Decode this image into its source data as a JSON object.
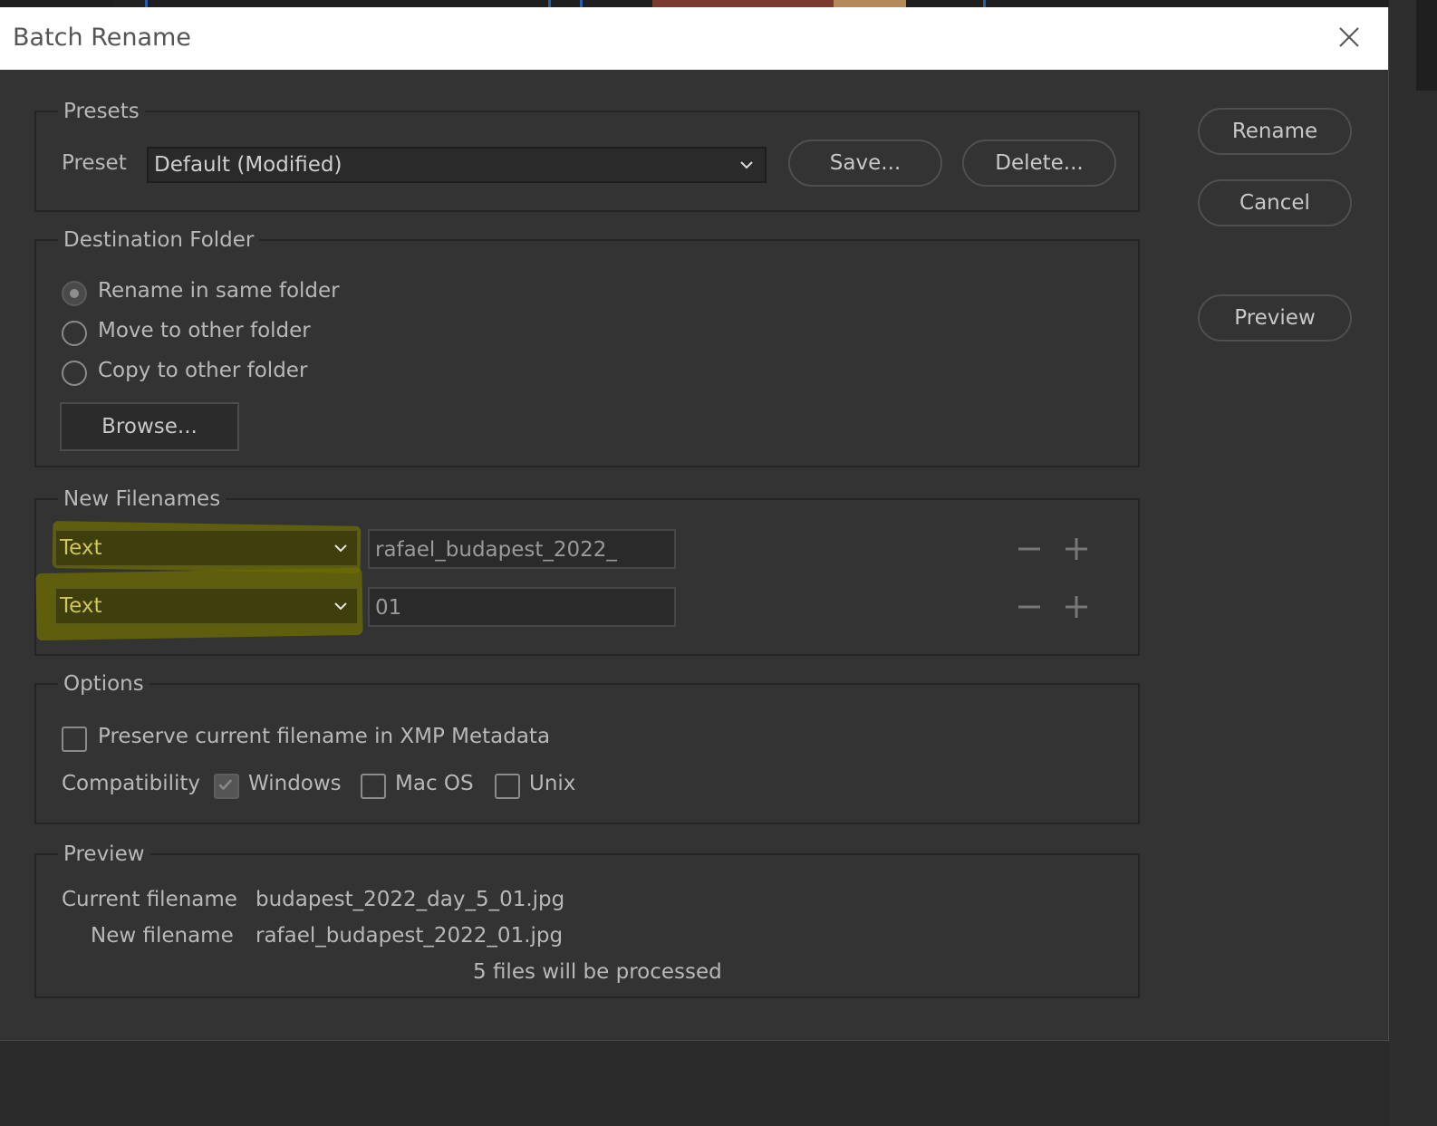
{
  "dialog": {
    "title": "Batch Rename"
  },
  "side_buttons": {
    "rename": "Rename",
    "cancel": "Cancel",
    "preview": "Preview"
  },
  "presets": {
    "legend": "Presets",
    "preset_label": "Preset",
    "preset_value": "Default (Modified)",
    "save_label": "Save...",
    "delete_label": "Delete..."
  },
  "destination": {
    "legend": "Destination Folder",
    "options": [
      {
        "label": "Rename in same folder",
        "selected": true
      },
      {
        "label": "Move to other folder",
        "selected": false
      },
      {
        "label": "Copy to other folder",
        "selected": false
      }
    ],
    "browse_label": "Browse..."
  },
  "new_filenames": {
    "legend": "New Filenames",
    "rows": [
      {
        "type": "Text",
        "value": "rafael_budapest_2022_"
      },
      {
        "type": "Text",
        "value": "01"
      }
    ]
  },
  "options": {
    "legend": "Options",
    "preserve_label": "Preserve current filename in XMP Metadata",
    "preserve_checked": false,
    "compatibility_label": "Compatibility",
    "compat": [
      {
        "label": "Windows",
        "checked": true
      },
      {
        "label": "Mac OS",
        "checked": false
      },
      {
        "label": "Unix",
        "checked": false
      }
    ]
  },
  "preview": {
    "legend": "Preview",
    "current_label": "Current filename",
    "current_value": "budapest_2022_day_5_01.jpg",
    "new_label": "New filename",
    "new_value": "rafael_budapest_2022_01.jpg",
    "summary": "5 files will be processed"
  },
  "colors": {
    "dialog_bg": "#333333",
    "highlight": "#6e6e00"
  }
}
